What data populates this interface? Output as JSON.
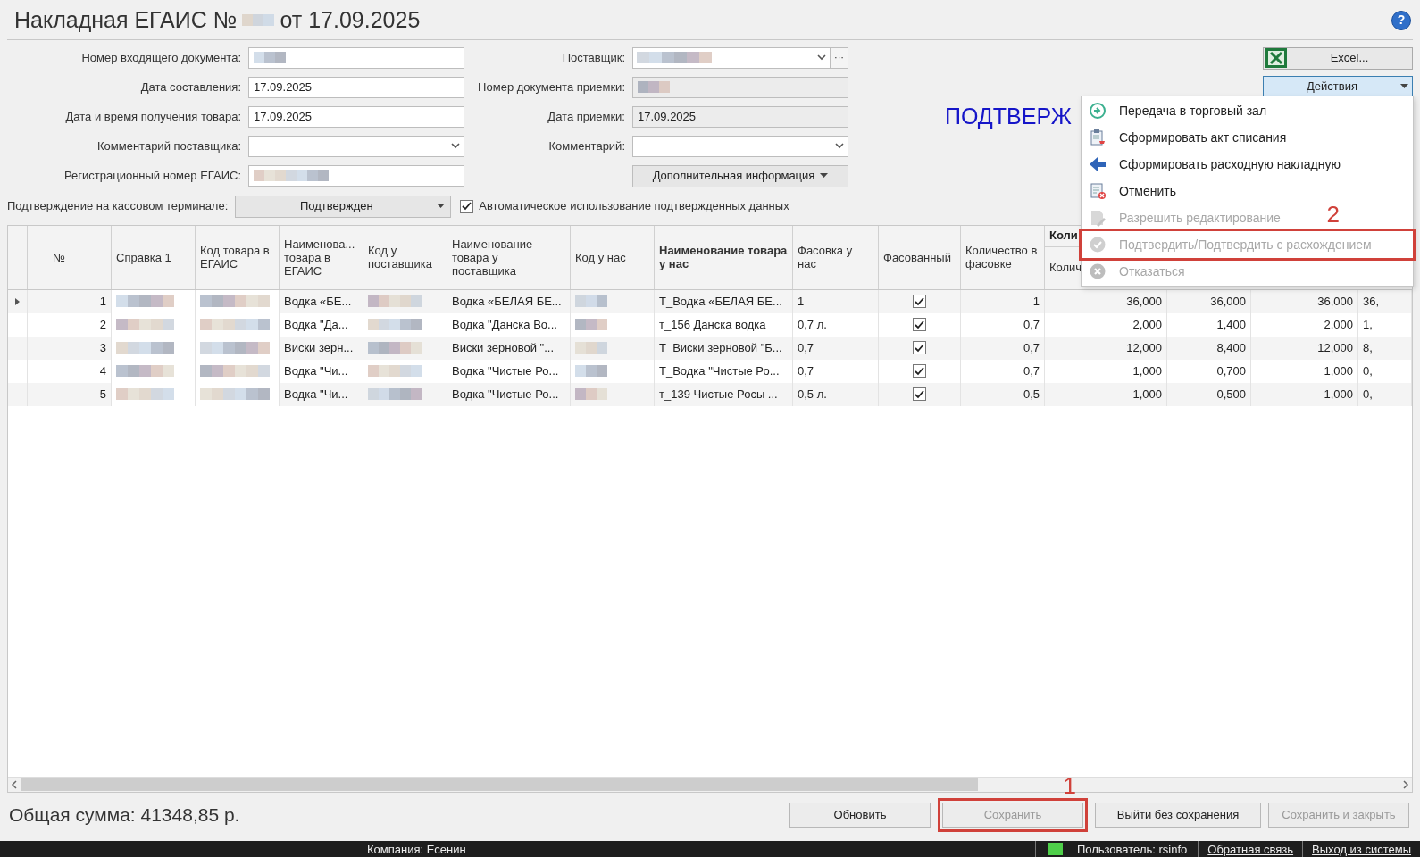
{
  "title": {
    "text": "Накладная ЕГАИС №",
    "date": "от 17.09.2025"
  },
  "help": "?",
  "left_fields": [
    {
      "label": "Номер входящего документа:",
      "kind": "blurred"
    },
    {
      "label": "Дата составления:",
      "kind": "text",
      "value": "17.09.2025"
    },
    {
      "label": "Дата и время получения товара:",
      "kind": "text",
      "value": "17.09.2025"
    },
    {
      "label": "Комментарий поставщика:",
      "kind": "combo"
    },
    {
      "label": "Регистрационный номер ЕГАИС:",
      "kind": "blurred"
    }
  ],
  "right_fields": [
    {
      "label": "Поставщик:",
      "kind": "lookup",
      "more": "···"
    },
    {
      "label": "Номер документа приемки:",
      "kind": "readonly_blurred"
    },
    {
      "label": "Дата приемки:",
      "kind": "readonly",
      "value": "17.09.2025"
    },
    {
      "label": "Комментарий:",
      "kind": "combo"
    }
  ],
  "extra_button": "Дополнительная информация",
  "terminal": {
    "label": "Подтверждение на кассовом терминале:",
    "value": "Подтвержден"
  },
  "auto_use": {
    "label": "Автоматическое использование подтвержденных данных",
    "checked": true
  },
  "status": "ПОДТВЕРЖ",
  "excel_button": "Excel...",
  "actions_button": {
    "label": "Действия",
    "expanded": true
  },
  "menu": [
    {
      "label": "Передача в торговый зал",
      "kind": "transfer",
      "disabled": false,
      "marked": false
    },
    {
      "label": "Сформировать акт списания",
      "kind": "writeoff",
      "disabled": false,
      "marked": false
    },
    {
      "label": "Сформировать расходную накладную",
      "kind": "invoice",
      "disabled": false,
      "marked": false
    },
    {
      "label": "Отменить",
      "kind": "cancel",
      "disabled": false,
      "marked": false
    },
    {
      "label": "Разрешить редактирование",
      "kind": "edit",
      "disabled": true,
      "marked": false
    },
    {
      "label": "Подтвердить/Подтвердить с расхождением",
      "kind": "confirm",
      "disabled": true,
      "marked": true,
      "annotation": "2"
    },
    {
      "label": "Отказаться",
      "kind": "refuse",
      "disabled": true,
      "marked": false
    }
  ],
  "columns": [
    {
      "label": "№",
      "bold": false
    },
    {
      "label": "Справка 1",
      "bold": false
    },
    {
      "label": "Код товара в ЕГАИС",
      "bold": false
    },
    {
      "label": "Наименова... товара в ЕГАИС",
      "bold": false
    },
    {
      "label": "Код у поставщика",
      "bold": false
    },
    {
      "label": "Наименование товара у поставщика",
      "bold": false
    },
    {
      "label": "Код у нас",
      "bold": false
    },
    {
      "label": "Наименование товара у нас",
      "bold": true
    },
    {
      "label": "Фасовка у нас",
      "bold": false
    },
    {
      "label": "Фасованный",
      "bold": false
    },
    {
      "label": "Количество в фасовке",
      "bold": false
    }
  ],
  "quantity_group": {
    "label": "Коли",
    "sub_label": "Колич"
  },
  "rows": [
    {
      "selected": true,
      "number": "1",
      "name_egais": "Водка «БЕ...",
      "name_supplier": "Водка «БЕЛАЯ БЕ...",
      "our_name": "Т_Водка «БЕЛАЯ БЕ...",
      "packing": "1",
      "packed": true,
      "pack_qty": "1",
      "quantities": [
        "36,000",
        "36,000",
        "36,000",
        "36,"
      ]
    },
    {
      "selected": false,
      "number": "2",
      "name_egais": "Водка \"Да...",
      "name_supplier": "Водка \"Данска Во...",
      "our_name": "т_156 Данска водка",
      "packing": "0,7 л.",
      "packed": true,
      "pack_qty": "0,7",
      "quantities": [
        "2,000",
        "1,400",
        "2,000",
        "1,"
      ]
    },
    {
      "selected": false,
      "number": "3",
      "name_egais": "Виски зерн...",
      "name_supplier": "Виски зерновой \"...",
      "our_name": "Т_Виски зерновой \"Б...",
      "packing": "0,7",
      "packed": true,
      "pack_qty": "0,7",
      "quantities": [
        "12,000",
        "8,400",
        "12,000",
        "8,"
      ]
    },
    {
      "selected": false,
      "number": "4",
      "name_egais": "Водка \"Чи...",
      "name_supplier": "Водка \"Чистые Ро...",
      "our_name": "Т_Водка \"Чистые Ро...",
      "packing": "0,7",
      "packed": true,
      "pack_qty": "0,7",
      "quantities": [
        "1,000",
        "0,700",
        "1,000",
        "0,"
      ]
    },
    {
      "selected": false,
      "number": "5",
      "name_egais": "Водка \"Чи...",
      "name_supplier": "Водка \"Чистые Ро...",
      "our_name": "т_139 Чистые Росы ...",
      "packing": "0,5 л.",
      "packed": true,
      "pack_qty": "0,5",
      "quantities": [
        "1,000",
        "0,500",
        "1,000",
        "0,"
      ]
    }
  ],
  "total": "Общая сумма: 41348,85 р.",
  "footer_buttons": [
    {
      "label": "Обновить",
      "disabled": false,
      "marked": false
    },
    {
      "label": "Сохранить",
      "disabled": true,
      "marked": true,
      "annotation": "1"
    },
    {
      "label": "Выйти без сохранения",
      "disabled": false,
      "marked": false
    },
    {
      "label": "Сохранить и закрыть",
      "disabled": true,
      "marked": false
    }
  ],
  "status_bar": {
    "company": "Компания: Есенин",
    "online": true,
    "user": "Пользователь: rsinfo",
    "links": [
      "Обратная связь",
      "Выход из системы"
    ]
  }
}
